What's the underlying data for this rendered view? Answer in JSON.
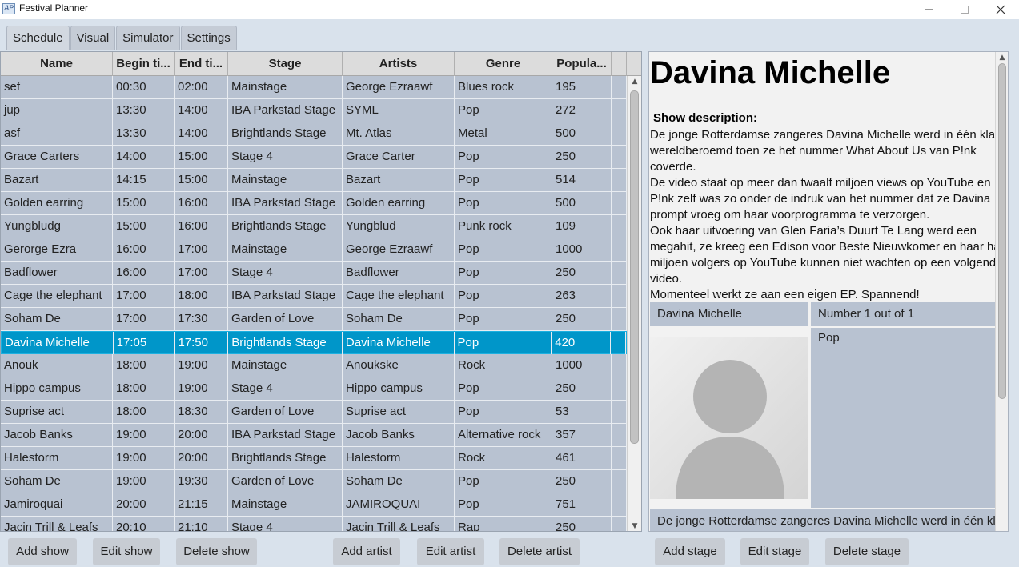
{
  "window": {
    "title": "Festival Planner",
    "icon": "app-icon"
  },
  "tabs": [
    "Schedule",
    "Visual",
    "Simulator",
    "Settings"
  ],
  "table": {
    "columns": [
      "Name",
      "Begin ti...",
      "End ti...",
      "Stage",
      "Artists",
      "Genre",
      "Popula..."
    ],
    "rows": [
      [
        "sef",
        "00:30",
        "02:00",
        "Mainstage",
        "George Ezraawf",
        "Blues rock",
        "195"
      ],
      [
        "jup",
        "13:30",
        "14:00",
        "IBA Parkstad Stage",
        "SYML",
        "Pop",
        "272"
      ],
      [
        "asf",
        "13:30",
        "14:00",
        "Brightlands Stage",
        "Mt. Atlas",
        "Metal",
        "500"
      ],
      [
        "Grace Carters",
        "14:00",
        "15:00",
        "Stage 4",
        "Grace Carter",
        "Pop",
        "250"
      ],
      [
        "Bazart",
        "14:15",
        "15:00",
        "Mainstage",
        "Bazart",
        "Pop",
        "514"
      ],
      [
        "Golden earring",
        "15:00",
        "16:00",
        "IBA Parkstad Stage",
        "Golden earring",
        "Pop",
        "500"
      ],
      [
        "Yungbludg",
        "15:00",
        "16:00",
        "Brightlands Stage",
        "Yungblud",
        "Punk rock",
        "109"
      ],
      [
        "Gerorge Ezra",
        "16:00",
        "17:00",
        "Mainstage",
        "George Ezraawf",
        "Pop",
        "1000"
      ],
      [
        "Badflower",
        "16:00",
        "17:00",
        "Stage 4",
        "Badflower",
        "Pop",
        "250"
      ],
      [
        "Cage the elephant",
        "17:00",
        "18:00",
        "IBA Parkstad Stage",
        "Cage the elephant",
        "Pop",
        "263"
      ],
      [
        "Soham De",
        "17:00",
        "17:30",
        "Garden of Love",
        "Soham De",
        "Pop",
        "250"
      ],
      [
        "Davina Michelle",
        "17:05",
        "17:50",
        "Brightlands Stage",
        "Davina Michelle",
        "Pop",
        "420"
      ],
      [
        "Anouk",
        "18:00",
        "19:00",
        "Mainstage",
        "Anoukske",
        "Rock",
        "1000"
      ],
      [
        "Hippo campus",
        "18:00",
        "19:00",
        "Stage 4",
        "Hippo campus",
        "Pop",
        "250"
      ],
      [
        "Suprise act",
        "18:00",
        "18:30",
        "Garden of Love",
        "Suprise act",
        "Pop",
        "53"
      ],
      [
        "Jacob Banks",
        "19:00",
        "20:00",
        "IBA Parkstad Stage",
        "Jacob Banks",
        "Alternative rock",
        "357"
      ],
      [
        "Halestorm",
        "19:00",
        "20:00",
        "Brightlands Stage",
        "Halestorm",
        "Rock",
        "461"
      ],
      [
        "Soham De",
        "19:00",
        "19:30",
        "Garden of Love",
        "Soham De",
        "Pop",
        "250"
      ],
      [
        "Jamiroquai",
        "20:00",
        "21:15",
        "Mainstage",
        "JAMIROQUAI",
        "Pop",
        "751"
      ],
      [
        "Jacin Trill & Leafs",
        "20:10",
        "21:10",
        "Stage 4",
        "Jacin Trill & Leafs",
        "Rap",
        "250"
      ]
    ],
    "selected_row": 11
  },
  "buttons": {
    "add_show": "Add show",
    "edit_show": "Edit show",
    "delete_show": "Delete show",
    "add_artist": "Add artist",
    "edit_artist": "Edit artist",
    "delete_artist": "Delete artist",
    "add_stage": "Add stage",
    "edit_stage": "Edit stage",
    "delete_stage": "Delete stage"
  },
  "detail": {
    "title": "Davina Michelle",
    "description_label": "Show description:",
    "description_lines": [
      "De jonge Rotterdamse zangeres Davina Michelle werd in één klap",
      "wereldberoemd toen ze het nummer What About Us van P!nk",
      "coverde.",
      "De video staat op meer dan twaalf miljoen views op YouTube en",
      "P!nk zelf was zo onder de indruk van het nummer dat ze Davina",
      "prompt vroeg om haar voorprogramma te verzorgen.",
      "Ook haar uitvoering van Glen Faria’s Duurt Te Lang werd een",
      "megahit, ze kreeg een Edison voor Beste Nieuwkomer en haar half",
      "miljoen volgers op YouTube kunnen niet wachten op een volgende",
      "video.",
      "Momenteel werkt ze aan een eigen EP. Spannend!"
    ],
    "artist_name": "Davina Michelle",
    "count": "Number 1 out of 1",
    "genre": "Pop",
    "bottom_text": "De jonge Rotterdamse zangeres Davina Michelle werd in één klap"
  }
}
